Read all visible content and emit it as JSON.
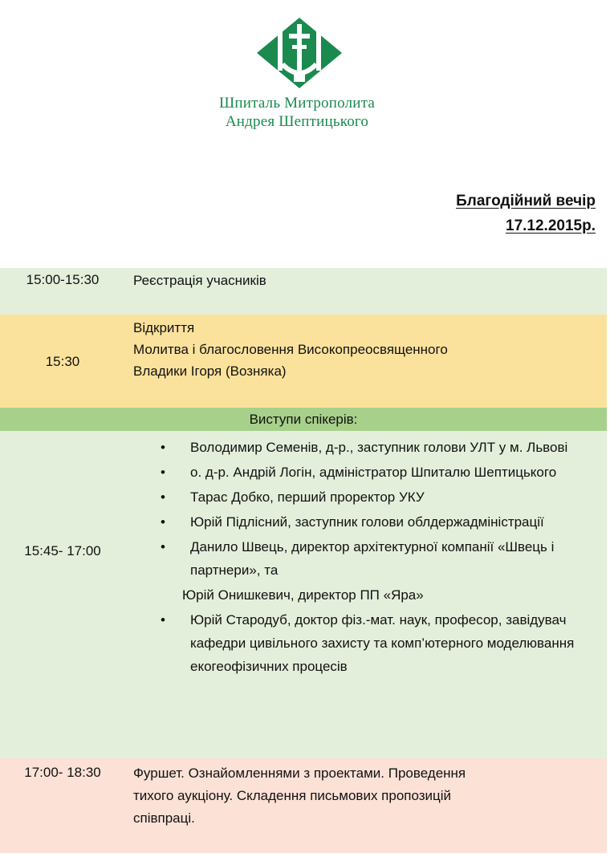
{
  "header": {
    "logo_icon": "hospital-cross-diamond-logo",
    "org_name_line1": "Шпиталь Митрополита",
    "org_name_line2": "Андрея Шептицького",
    "event_title": "Благодійний вечір",
    "event_date": "17.12.2015р."
  },
  "colors": {
    "brand_green": "#1a8a4e",
    "row_light_green": "#e4efdb",
    "row_yellow": "#fbe29c",
    "row_green_header": "#a7d08b",
    "row_pink": "#fbe1d6"
  },
  "schedule": [
    {
      "time": "15:00-15:30",
      "lines": [
        "Реєстрація учасників"
      ]
    },
    {
      "time": "15:30",
      "lines": [
        "Відкриття",
        "Молитва і благословення Високопреосвященного",
        "Владики Ігоря (Возняка)"
      ]
    },
    {
      "heading": "Виступи спікерів:"
    },
    {
      "time": "15:45- 17:00",
      "bullet_icon": "bullet-dot-icon",
      "speakers": [
        "Володимир Семенів, д-р., заступник голови УЛТ у м. Львові",
        "о. д-р. Андрій Логін, адміністратор Шпиталю Шептицького",
        "Тарас Добко, перший проректор УКУ",
        "Юрій Підлісний, заступник голови облдержадміністрації",
        "Данило Швець, директор архітектурної компанії «Швець і партнери», та",
        "Юрій Стародуб, доктор фіз.-мат. наук, професор, завідувач кафедри цивільного захисту та комп’ютерного моделювання екогеофізичних процесів"
      ],
      "extra_line": "Юрій Онишкевич, директор ПП «Яра»"
    },
    {
      "time": "17:00- 18:30",
      "lines": [
        "Фуршет. Ознайомленнями з проектами. Проведення",
        "тихого аукціону. Складення письмових пропозицій",
        "співпраці."
      ]
    }
  ]
}
